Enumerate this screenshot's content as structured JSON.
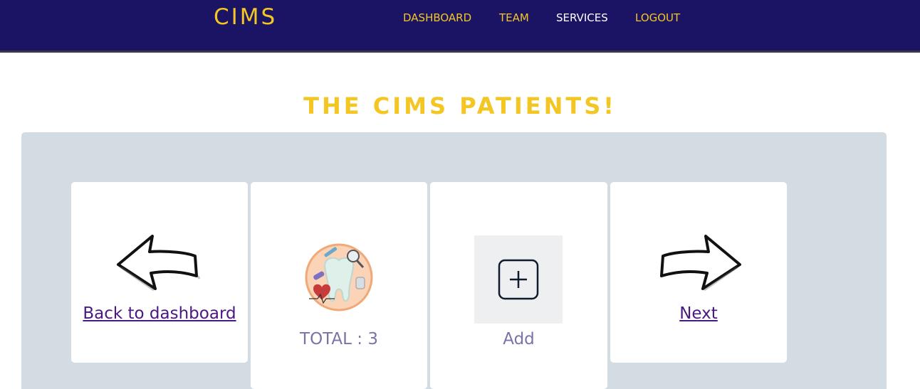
{
  "brand": "CIMS",
  "nav": {
    "dashboard": "DASHBOARD",
    "team": "TEAM",
    "services": "SERVICES",
    "logout": "LOGOUT"
  },
  "page_title": "THE CIMS PATIENTS!",
  "cards": {
    "back_label": "Back to dashboard",
    "total_label": "TOTAL : 3",
    "add_label": "Add",
    "next_label": "Next"
  },
  "icons": {
    "back": "left-arrow-icon",
    "total": "dental-tooth-icon",
    "add": "plus-square-icon",
    "next": "right-arrow-icon"
  },
  "colors": {
    "navbar": "#1b1464",
    "accent": "#f3c623",
    "panel": "#d3dbe3",
    "link": "#4a1880",
    "caption": "#7a73a6"
  }
}
